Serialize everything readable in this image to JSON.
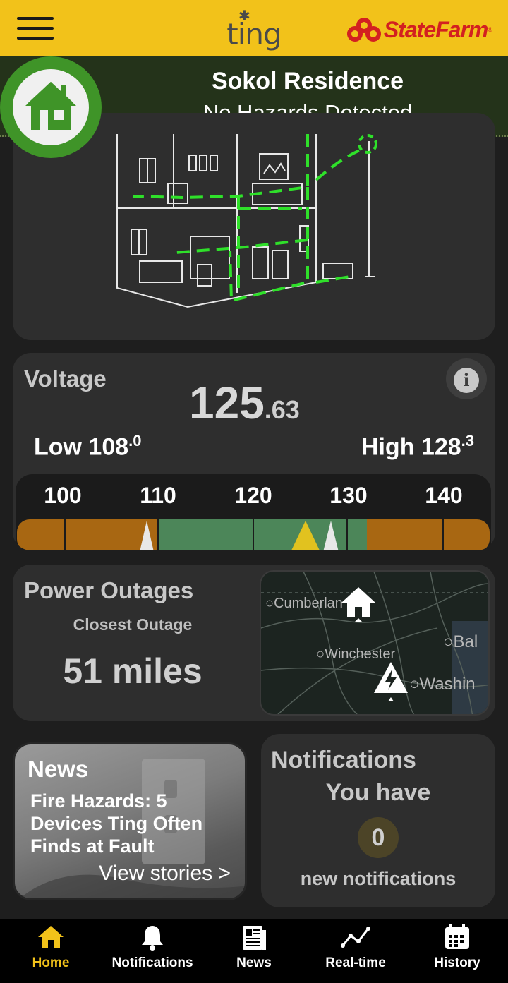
{
  "header": {
    "menu_icon": "hamburger-menu-icon",
    "app_logo": "ting",
    "partner_logo": "StateFarm"
  },
  "status": {
    "residence": "Sokol Residence",
    "message": "No Hazards Detected",
    "icon": "home-icon",
    "badge_color": "#3f9428"
  },
  "voltage": {
    "label": "Voltage",
    "value_whole": "125",
    "value_decimal": ".63",
    "low_label": "Low 108",
    "low_decimal": ".0",
    "high_label": "High 128",
    "high_decimal": ".3",
    "scale_ticks": [
      "100",
      "110",
      "120",
      "130",
      "140"
    ],
    "scale_min": 100,
    "scale_max": 140,
    "zone_colors": {
      "warning": "#a86712",
      "normal": "#4c8659",
      "current": "#e1c21f",
      "limits": "#e8e8e8"
    }
  },
  "outages": {
    "title": "Power Outages",
    "subtitle": "Closest Outage",
    "distance": "51 miles",
    "map_labels": {
      "cumberland": "Cumberlan",
      "winchester": "Winchester",
      "baltimore": "Bal",
      "washington": "Washin"
    }
  },
  "news": {
    "title": "News",
    "headline": "Fire Hazards: 5 Devices Ting Often Finds at Fault",
    "link": "View stories >"
  },
  "notifications": {
    "title": "Notifications",
    "line1": "You have",
    "count": "0",
    "line2": "new notifications"
  },
  "nav": [
    {
      "label": "Home",
      "icon": "home-icon",
      "active": true
    },
    {
      "label": "Notifications",
      "icon": "bell-icon",
      "active": false
    },
    {
      "label": "News",
      "icon": "newspaper-icon",
      "active": false
    },
    {
      "label": "Real-time",
      "icon": "line-graph-icon",
      "active": false
    },
    {
      "label": "History",
      "icon": "calendar-icon",
      "active": false
    }
  ],
  "colors": {
    "accent": "#f2c21a",
    "brand_red": "#d32020",
    "background": "#1e1e1e",
    "card": "#2e2e2e"
  }
}
